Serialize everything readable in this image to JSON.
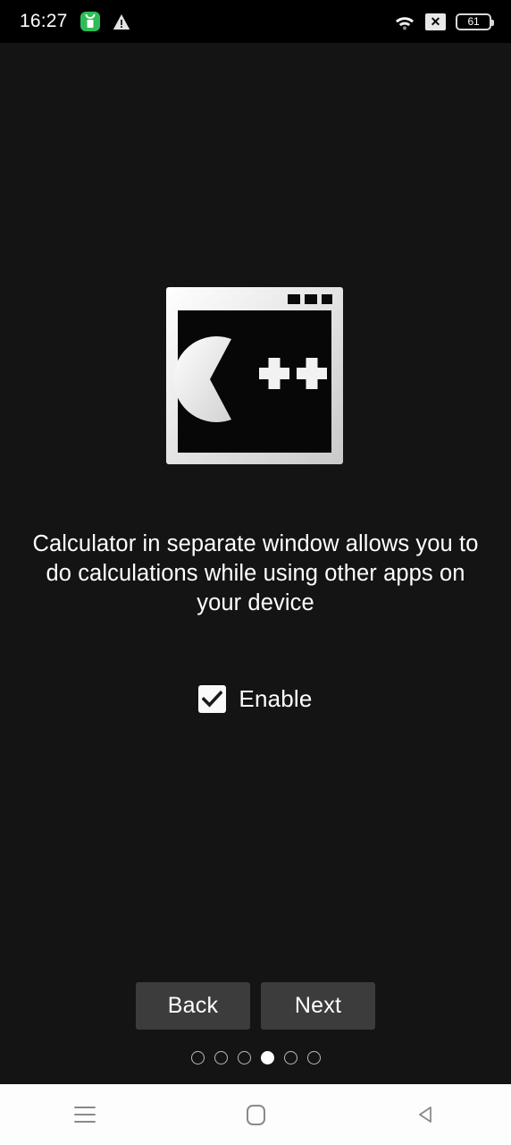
{
  "status_bar": {
    "time": "16:27",
    "left_icons": [
      {
        "name": "app-notification-icon",
        "label": "app notification"
      },
      {
        "name": "warning-icon",
        "label": "warning"
      }
    ],
    "right_icons": [
      {
        "name": "wifi-icon",
        "label": "wifi"
      },
      {
        "name": "no-sim-icon",
        "label": "x"
      }
    ],
    "battery_level": "61",
    "background_color": "#000000"
  },
  "screen": {
    "background_color": "#141414",
    "text_color": "#ffffff",
    "app_icon": {
      "name": "cpp-window-icon",
      "label": "Calculator++ window icon"
    },
    "description": "Calculator in separate window allows you to do calculations while using other apps on your device",
    "checkbox": {
      "label": "Enable",
      "checked": true
    },
    "buttons": {
      "back_label": "Back",
      "next_label": "Next",
      "button_color": "#3c3c3c"
    },
    "pager": {
      "total": 6,
      "active_index": 4,
      "active_color": "#ffffff",
      "inactive_color": "#b9b9b9"
    }
  },
  "nav_bar": {
    "background_color": "#fdfdfd",
    "icon_color": "#8a8a8a",
    "items": [
      {
        "name": "nav-recents-button",
        "label": "Recents"
      },
      {
        "name": "nav-home-button",
        "label": "Home"
      },
      {
        "name": "nav-back-button",
        "label": "Back"
      }
    ]
  }
}
